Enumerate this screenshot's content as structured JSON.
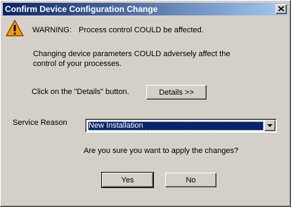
{
  "window": {
    "title": "Confirm Device Configuration Change"
  },
  "warning": {
    "label": "WARNING:",
    "message": "Process control COULD be affected."
  },
  "description": {
    "line1": "Changing device parameters COULD adversely affect the",
    "line2": "control of your processes."
  },
  "details": {
    "instruction": "Click on the \"Details\" button.",
    "button_label": "Details >>"
  },
  "service_reason": {
    "label": "Service Reason",
    "selected": "New Installation"
  },
  "confirm_question": "Are you sure you want to apply the changes?",
  "buttons": {
    "yes": "Yes",
    "no": "No"
  },
  "icons": {
    "warning": "warning-icon",
    "close": "close-icon",
    "dropdown": "chevron-down-icon"
  },
  "colors": {
    "titlebar_start": "#0a246a",
    "titlebar_end": "#a6caf0",
    "warning_fill": "#f59a00"
  }
}
